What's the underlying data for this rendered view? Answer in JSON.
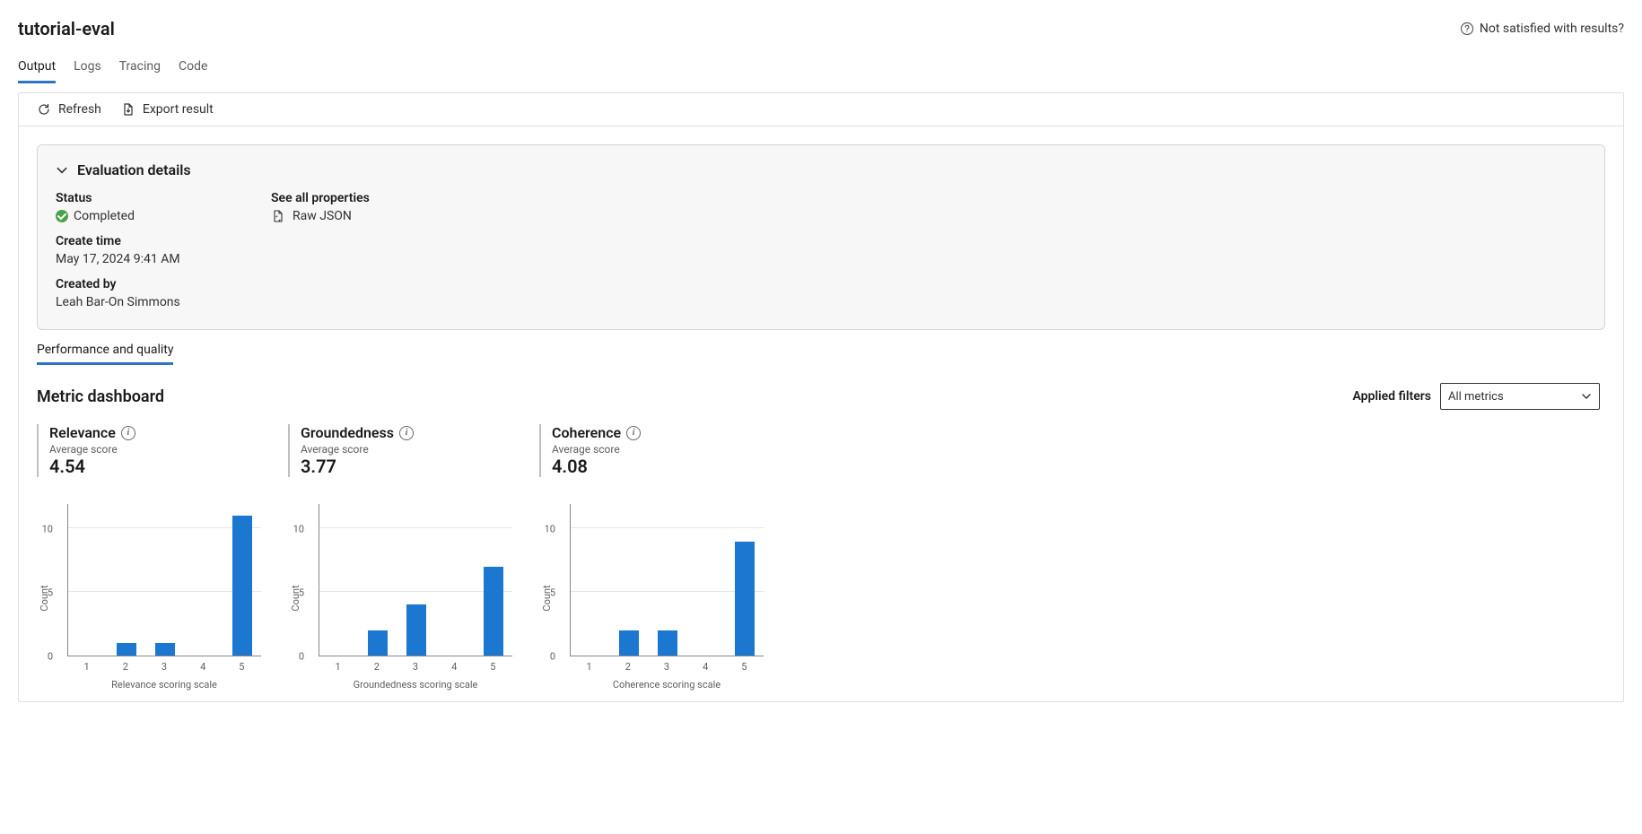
{
  "header": {
    "title": "tutorial-eval",
    "feedback_label": "Not satisfied with results?"
  },
  "tabs": [
    {
      "id": "output",
      "label": "Output",
      "active": true
    },
    {
      "id": "logs",
      "label": "Logs",
      "active": false
    },
    {
      "id": "tracing",
      "label": "Tracing",
      "active": false
    },
    {
      "id": "code",
      "label": "Code",
      "active": false
    }
  ],
  "toolbar": {
    "refresh_label": "Refresh",
    "export_label": "Export result"
  },
  "evaluation_details": {
    "panel_title": "Evaluation details",
    "status_label": "Status",
    "status_value": "Completed",
    "create_time_label": "Create time",
    "create_time_value": "May 17, 2024 9:41 AM",
    "created_by_label": "Created by",
    "created_by_value": "Leah Bar-On Simmons",
    "properties_label": "See all properties",
    "raw_json_label": "Raw JSON"
  },
  "subtab": {
    "label": "Performance and quality"
  },
  "dashboard": {
    "title": "Metric dashboard",
    "filter_label": "Applied filters",
    "filter_value": "All metrics"
  },
  "metrics": [
    {
      "id": "relevance",
      "title": "Relevance",
      "avg_label": "Average score",
      "avg_value": "4.54"
    },
    {
      "id": "groundedness",
      "title": "Groundedness",
      "avg_label": "Average score",
      "avg_value": "3.77"
    },
    {
      "id": "coherence",
      "title": "Coherence",
      "avg_label": "Average score",
      "avg_value": "4.08"
    }
  ],
  "chart_data": [
    {
      "metric": "relevance",
      "type": "bar",
      "categories": [
        "1",
        "2",
        "3",
        "4",
        "5"
      ],
      "values": [
        0,
        1,
        1,
        0,
        11
      ],
      "xlabel": "Relevance scoring scale",
      "ylabel": "Count",
      "y_ticks": [
        0,
        5,
        10
      ],
      "ymax": 12
    },
    {
      "metric": "groundedness",
      "type": "bar",
      "categories": [
        "1",
        "2",
        "3",
        "4",
        "5"
      ],
      "values": [
        0,
        2,
        4,
        0,
        7
      ],
      "xlabel": "Groundedness scoring scale",
      "ylabel": "Count",
      "y_ticks": [
        0,
        5,
        10
      ],
      "ymax": 12
    },
    {
      "metric": "coherence",
      "type": "bar",
      "categories": [
        "1",
        "2",
        "3",
        "4",
        "5"
      ],
      "values": [
        0,
        2,
        2,
        0,
        9
      ],
      "xlabel": "Coherence scoring scale",
      "ylabel": "Count",
      "y_ticks": [
        0,
        5,
        10
      ],
      "ymax": 12
    }
  ]
}
